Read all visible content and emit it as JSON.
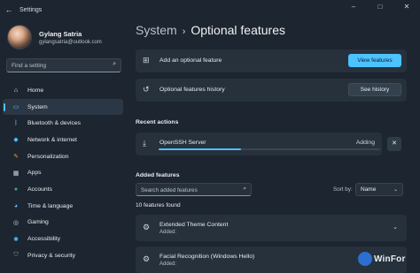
{
  "window": {
    "title": "Settings",
    "controls": {
      "minimize": "–",
      "maximize": "□",
      "close": "✕"
    }
  },
  "profile": {
    "name": "Gylang Satria",
    "email": "gylangsatria@outlook.com"
  },
  "sidebar": {
    "search_placeholder": "Find a setting",
    "items": [
      {
        "label": "Home",
        "icon": "home-icon",
        "glyph": "⌂",
        "color": "#e8ecef"
      },
      {
        "label": "System",
        "icon": "monitor-icon",
        "glyph": "▭",
        "color": "#4cc2ff",
        "active": true
      },
      {
        "label": "Bluetooth & devices",
        "icon": "bluetooth-icon",
        "glyph": "ᛒ",
        "color": "#4cc2ff"
      },
      {
        "label": "Network & internet",
        "icon": "wifi-icon",
        "glyph": "◆",
        "color": "#4cc2ff"
      },
      {
        "label": "Personalization",
        "icon": "brush-icon",
        "glyph": "✎",
        "color": "#e39b46"
      },
      {
        "label": "Apps",
        "icon": "apps-icon",
        "glyph": "▦",
        "color": "#cfd6dd"
      },
      {
        "label": "Accounts",
        "icon": "person-icon",
        "glyph": "●",
        "color": "#37b36c"
      },
      {
        "label": "Time & language",
        "icon": "globe-icon",
        "glyph": "◕",
        "color": "#4cc2ff"
      },
      {
        "label": "Gaming",
        "icon": "gamepad-icon",
        "glyph": "◎",
        "color": "#cfd6dd"
      },
      {
        "label": "Accessibility",
        "icon": "accessibility-icon",
        "glyph": "✱",
        "color": "#4cc2ff"
      },
      {
        "label": "Privacy & security",
        "icon": "shield-icon",
        "glyph": "⛉",
        "color": "#8895a3"
      }
    ]
  },
  "main": {
    "breadcrumb": {
      "parent": "System",
      "separator": "›",
      "current": "Optional features"
    },
    "add_feature": {
      "label": "Add an optional feature",
      "button": "View features"
    },
    "history": {
      "label": "Optional features history",
      "button": "See history"
    },
    "recent_actions": {
      "heading": "Recent actions",
      "item": {
        "name": "OpenSSH Server",
        "status": "Adding",
        "progress": 0.37
      }
    },
    "added_features": {
      "heading": "Added features",
      "search_placeholder": "Search added features",
      "sort_label": "Sort by:",
      "sort_value": "Name",
      "count": "10 features found",
      "items": [
        {
          "name": "Extended Theme Content",
          "sub": "Added:"
        },
        {
          "name": "Facial Recognition (Windows Hello)",
          "sub": "Added:"
        }
      ]
    }
  },
  "watermark": "WinFor"
}
